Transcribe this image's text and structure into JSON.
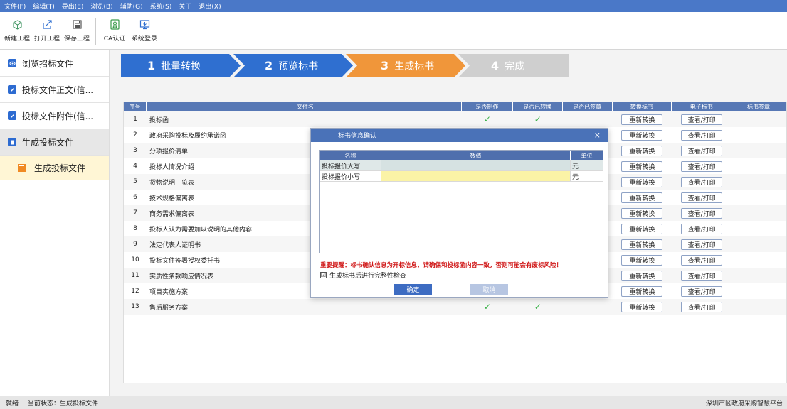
{
  "menu": [
    "文件(F)",
    "编辑(T)",
    "导出(E)",
    "浏览(B)",
    "辅助(G)",
    "系统(S)",
    "关于",
    "退出(X)"
  ],
  "toolbar": {
    "new_project": "新建工程",
    "open_project": "打开工程",
    "save_project": "保存工程",
    "ca_auth": "CA认证",
    "system_login": "系统登录"
  },
  "sidebar": {
    "items": [
      {
        "label": "浏览招标文件",
        "icon": "eye-icon"
      },
      {
        "label": "投标文件正文(信...",
        "icon": "edit-icon"
      },
      {
        "label": "投标文件附件(信...",
        "icon": "edit-icon"
      },
      {
        "label": "生成投标文件",
        "icon": "file-icon"
      }
    ],
    "sub_item": {
      "label": "生成投标文件",
      "icon": "list-icon"
    }
  },
  "steps": [
    {
      "num": "1",
      "label": "批量转换",
      "color": "#2f6fd0"
    },
    {
      "num": "2",
      "label": "预览标书",
      "color": "#2f6fd0"
    },
    {
      "num": "3",
      "label": "生成标书",
      "color": "#f0963a"
    },
    {
      "num": "4",
      "label": "完成",
      "color": "#cfcfcf"
    }
  ],
  "table": {
    "headers": [
      "序号",
      "文件名",
      "是否制作",
      "是否已转换",
      "是否已签章",
      "转换标书",
      "电子标书",
      "标书签章"
    ],
    "reconvert_label": "重新转换",
    "view_print_label": "查看/打印",
    "check_mark": "✓",
    "rows": [
      {
        "no": "1",
        "name": "投标函",
        "made": true,
        "converted": true
      },
      {
        "no": "2",
        "name": "政府采购投标及履约承诺函",
        "made": false,
        "converted": false
      },
      {
        "no": "3",
        "name": "分项报价清单",
        "made": false,
        "converted": false
      },
      {
        "no": "4",
        "name": "投标人情况介绍",
        "made": false,
        "converted": false
      },
      {
        "no": "5",
        "name": "货物说明一览表",
        "made": false,
        "converted": false
      },
      {
        "no": "6",
        "name": "技术规格偏离表",
        "made": false,
        "converted": false
      },
      {
        "no": "7",
        "name": "商务需求偏离表",
        "made": false,
        "converted": false
      },
      {
        "no": "8",
        "name": "投标人认为需要加以说明的其他内容",
        "made": false,
        "converted": false
      },
      {
        "no": "9",
        "name": "法定代表人证明书",
        "made": false,
        "converted": false
      },
      {
        "no": "10",
        "name": "投标文件签署授权委托书",
        "made": false,
        "converted": false
      },
      {
        "no": "11",
        "name": "实质性条款响应情况表",
        "made": false,
        "converted": false
      },
      {
        "no": "12",
        "name": "项目实施方案",
        "made": false,
        "converted": false
      },
      {
        "no": "13",
        "name": "售后服务方案",
        "made": true,
        "converted": true
      }
    ]
  },
  "dialog": {
    "title": "标书信息确认",
    "close": "×",
    "grid_headers": [
      "名称",
      "数值",
      "单位"
    ],
    "grid_rows": [
      {
        "name": "投标报价大写",
        "value": "",
        "unit": "元"
      },
      {
        "name": "投标报价小写",
        "value": "",
        "unit": "元"
      }
    ],
    "warning": "重要提醒：标书确认信息为开标信息，请确保和投标函内容一致，否则可能会有废标风险！",
    "check_label": "生成标书后进行完整性检查",
    "check_mark": "☑",
    "ok": "确定",
    "cancel": "取消"
  },
  "status": {
    "ready": "就绪",
    "current_state": "当前状态：生成投标文件",
    "right": "深圳市区政府采购智慧平台"
  }
}
